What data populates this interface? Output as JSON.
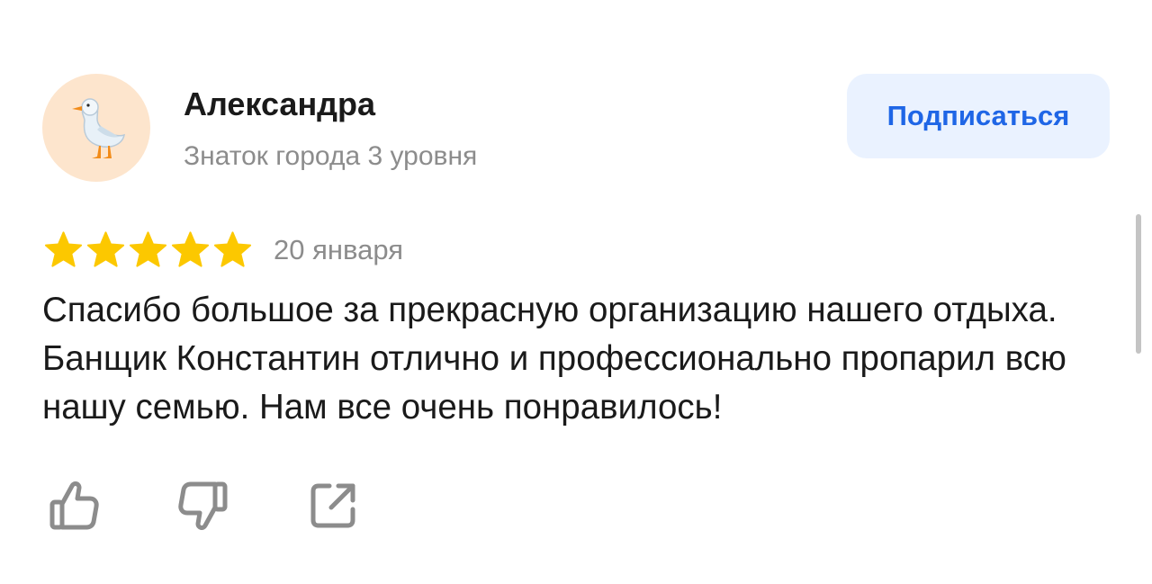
{
  "author": {
    "name": "Александра",
    "level": "Знаток города 3 уровня",
    "avatar_icon": "goose-icon",
    "avatar_bg": "#fde5cd"
  },
  "subscribe": {
    "label": "Подписаться"
  },
  "review": {
    "rating": 5,
    "rating_max": 5,
    "date": "20 января",
    "text": "Спасибо большое за прекрасную организацию нашего отдыха. Банщик Константин отлично и профессионально пропарил всю нашу семью. Нам все очень понравилось!"
  },
  "actions": {
    "like_icon": "thumbs-up-icon",
    "dislike_icon": "thumbs-down-icon",
    "share_icon": "share-icon"
  },
  "colors": {
    "star": "#fcc800",
    "accent": "#1f66e6",
    "button_bg": "#eaf2ff",
    "secondary_text": "#8c8c8c",
    "icon": "#8c8c8c"
  }
}
